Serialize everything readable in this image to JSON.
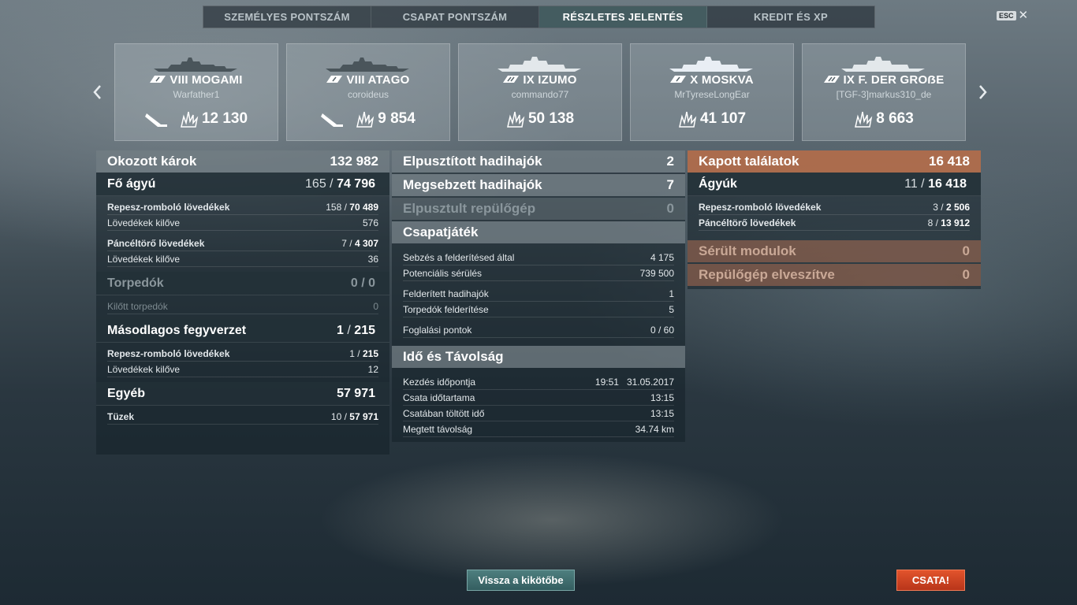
{
  "tabs": [
    {
      "label": "SZEMÉLYES PONTSZÁM",
      "active": false
    },
    {
      "label": "CSAPAT PONTSZÁM",
      "active": false
    },
    {
      "label": "RÉSZLETES JELENTÉS",
      "active": true
    },
    {
      "label": "KREDIT ÉS XP",
      "active": false
    }
  ],
  "esc": {
    "key": "ESC",
    "close": "✕"
  },
  "cards": [
    {
      "tier_name": "VIII MOGAMI",
      "player": "Warfather1",
      "score": "12 130",
      "sunk": true
    },
    {
      "tier_name": "VIII ATAGO",
      "player": "coroideus",
      "score": "9 854",
      "sunk": true
    },
    {
      "tier_name": "IX IZUMO",
      "player": "commando77",
      "score": "50 138",
      "sunk": false
    },
    {
      "tier_name": "X MOSKVA",
      "player": "MrTyreseLongEar",
      "score": "41 107",
      "sunk": false
    },
    {
      "tier_name": "IX F. DER GROẞE",
      "player": "[TGF-3]markus310_de",
      "score": "8 663",
      "sunk": false
    }
  ],
  "left": {
    "damage": {
      "label": "Okozott károk",
      "value": "132 982"
    },
    "main": {
      "label": "Fő ágyú",
      "hits": "165",
      "total": "74 796"
    },
    "he": {
      "label": "Repesz-romboló lövedékek",
      "hits": "158",
      "total": "70 489"
    },
    "he_fired": {
      "label": "Lövedékek kilőve",
      "value": "576"
    },
    "ap": {
      "label": "Páncéltörő lövedékek",
      "hits": "7",
      "total": "4 307"
    },
    "ap_fired": {
      "label": "Lövedékek kilőve",
      "value": "36"
    },
    "torp": {
      "label": "Torpedók",
      "value": "0 / 0"
    },
    "torp_fired": {
      "label": "Kilőtt torpedók",
      "value": "0"
    },
    "secondary": {
      "label": "Másodlagos fegyverzet",
      "hits": "1",
      "total": "215"
    },
    "sec_he": {
      "label": "Repesz-romboló lövedékek",
      "hits": "1",
      "total": "215"
    },
    "sec_fired": {
      "label": "Lövedékek kilőve",
      "value": "12"
    },
    "other": {
      "label": "Egyéb",
      "value": "57 971"
    },
    "fires": {
      "label": "Tüzek",
      "hits": "10",
      "total": "57 971"
    }
  },
  "middle": {
    "destroyed": {
      "label": "Elpusztított hadihajók",
      "value": "2"
    },
    "damaged": {
      "label": "Megsebzett hadihajók",
      "value": "7"
    },
    "planes": {
      "label": "Elpusztult repülőgép",
      "value": "0"
    },
    "team": {
      "label": "Csapatjáték"
    },
    "spot_dmg": {
      "label": "Sebzés a felderítésed által",
      "value": "4 175"
    },
    "potential": {
      "label": "Potenciális sérülés",
      "value": "739 500"
    },
    "spotted": {
      "label": "Felderített hadihajók",
      "value": "1"
    },
    "torp_spot": {
      "label": "Torpedók felderítése",
      "value": "5"
    },
    "capture": {
      "label": "Foglalási pontok",
      "value": "0 / 60"
    },
    "time_hdr": {
      "label": "Idő és Távolság"
    },
    "start": {
      "label": "Kezdés időpontja",
      "value": "19:51   31.05.2017"
    },
    "duration": {
      "label": "Csata időtartama",
      "value": "13:15"
    },
    "in_battle": {
      "label": "Csatában töltött idő",
      "value": "13:15"
    },
    "distance": {
      "label": "Megtett távolság",
      "value": "34.74 km"
    }
  },
  "right": {
    "received": {
      "label": "Kapott találatok",
      "value": "16 418"
    },
    "guns": {
      "label": "Ágyúk",
      "hits": "11",
      "total": "16 418"
    },
    "he": {
      "label": "Repesz-romboló lövedékek",
      "hits": "3",
      "total": "2 506"
    },
    "ap": {
      "label": "Páncéltörő lövedékek",
      "hits": "8",
      "total": "13 912"
    },
    "modules": {
      "label": "Sérült modulok",
      "value": "0"
    },
    "planes_lost": {
      "label": "Repülőgép elveszítve",
      "value": "0"
    }
  },
  "buttons": {
    "back": "Vissza a kikötőbe",
    "battle": "CSATA!"
  },
  "colors": {
    "accent_orange": "#cd7850",
    "battle": "#d9482a",
    "back": "#3f6e70"
  }
}
